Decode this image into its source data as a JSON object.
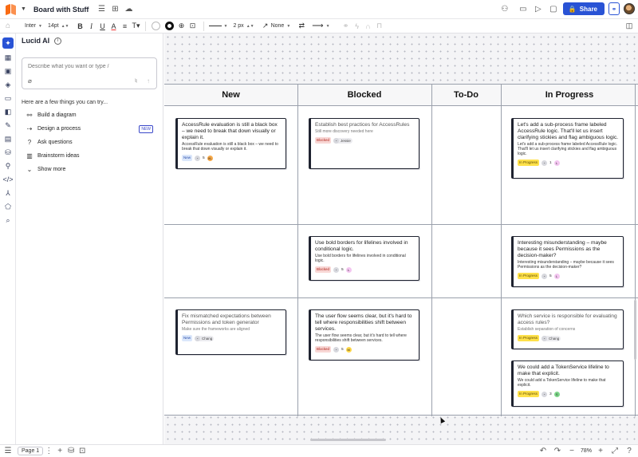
{
  "header": {
    "doc_title": "Board with Stuff",
    "share_label": "Share"
  },
  "toolbar": {
    "font_family": "Inter",
    "font_size": "14pt",
    "line_width": "2 px",
    "arrow_start": "None"
  },
  "ai_panel": {
    "title": "Lucid AI",
    "prompt_placeholder": "Describe what you want or type /",
    "try_label": "Here are a few things you can try...",
    "suggestions": [
      {
        "label": "Build a diagram",
        "icon": "diagram-icon"
      },
      {
        "label": "Design a process",
        "icon": "process-icon",
        "badge": "NEW"
      },
      {
        "label": "Ask questions",
        "icon": "question-icon"
      },
      {
        "label": "Brainstorm ideas",
        "icon": "brainstorm-icon"
      },
      {
        "label": "Show more",
        "icon": "chevron-down-icon"
      }
    ]
  },
  "board": {
    "columns": [
      "New",
      "Blocked",
      "To-Do",
      "In Progress"
    ],
    "cards": [
      {
        "col": "New",
        "title": "AccessRule evaluation is still a black box – we need to break that down visually or explain it.",
        "desc": "AccessRule evaluation is still a black box – we need to break that down visually or explain it.",
        "tag": "New",
        "count": "5",
        "badge": "XL"
      },
      {
        "col": "New",
        "title": "Fix mismatched expectations between Permissions and token generator",
        "desc": "Make sure the frameworks are aligned",
        "tag": "New",
        "assignee": "Chang"
      },
      {
        "col": "Blocked",
        "title": "Establish best practices for AccessRules",
        "desc": "Still more discovery needed here",
        "tag": "Blocked",
        "assignee": "Jessie"
      },
      {
        "col": "Blocked",
        "title": "Use bold borders for lifelines involved in conditional logic.",
        "desc": "Use bold borders for lifelines involved in conditional logic.",
        "tag": "Blocked",
        "count": "5",
        "badge": "L"
      },
      {
        "col": "Blocked",
        "title": "The user flow seems clear, but it's hard to tell where responsibilities shift between services.",
        "desc": "The user flow seems clear, but it's hard to tell where responsibilities shift between services.",
        "tag": "Blocked",
        "count": "5",
        "badge": "M"
      },
      {
        "col": "In Progress",
        "title": "Let's add a sub-process frame labeled AccessRule logic. That'll let us insert clarifying stickies and flag ambiguous logic.",
        "desc": "Let's add a sub-process frame labeled AccessRule logic. That'll let us insert clarifying stickies and flag ambiguous logic.",
        "tag": "In Progress",
        "count": "1",
        "badge": "L"
      },
      {
        "col": "In Progress",
        "title": "Interesting misunderstanding – maybe because it sees Permissions as the decision-maker?",
        "desc": "Interesting misunderstanding – maybe because it sees Permissions as the decision-maker?",
        "tag": "In Progress",
        "count": "5",
        "badge": "L"
      },
      {
        "col": "In Progress",
        "title": "Which service is responsible for evaluating access rules?",
        "desc": "Establish separation of concerns",
        "tag": "In Progress",
        "assignee": "Chang"
      },
      {
        "col": "In Progress",
        "title": "We could add a TokenService lifeline to make that explicit.",
        "desc": "We could add a TokenService lifeline to make that explicit.",
        "tag": "In Progress",
        "count": "3",
        "badge": "S"
      }
    ]
  },
  "footer": {
    "page_label": "Page 1",
    "zoom": "78%"
  },
  "colors": {
    "accent": "#2953d5",
    "tag_new": "#dbe7fb",
    "tag_blocked": "#f8d7d5",
    "tag_progress": "#ffe14a",
    "badge_xl": "#f6a94a",
    "badge_l": "#f3c6f0",
    "badge_m": "#ffd84a",
    "badge_s": "#7ed68a"
  }
}
